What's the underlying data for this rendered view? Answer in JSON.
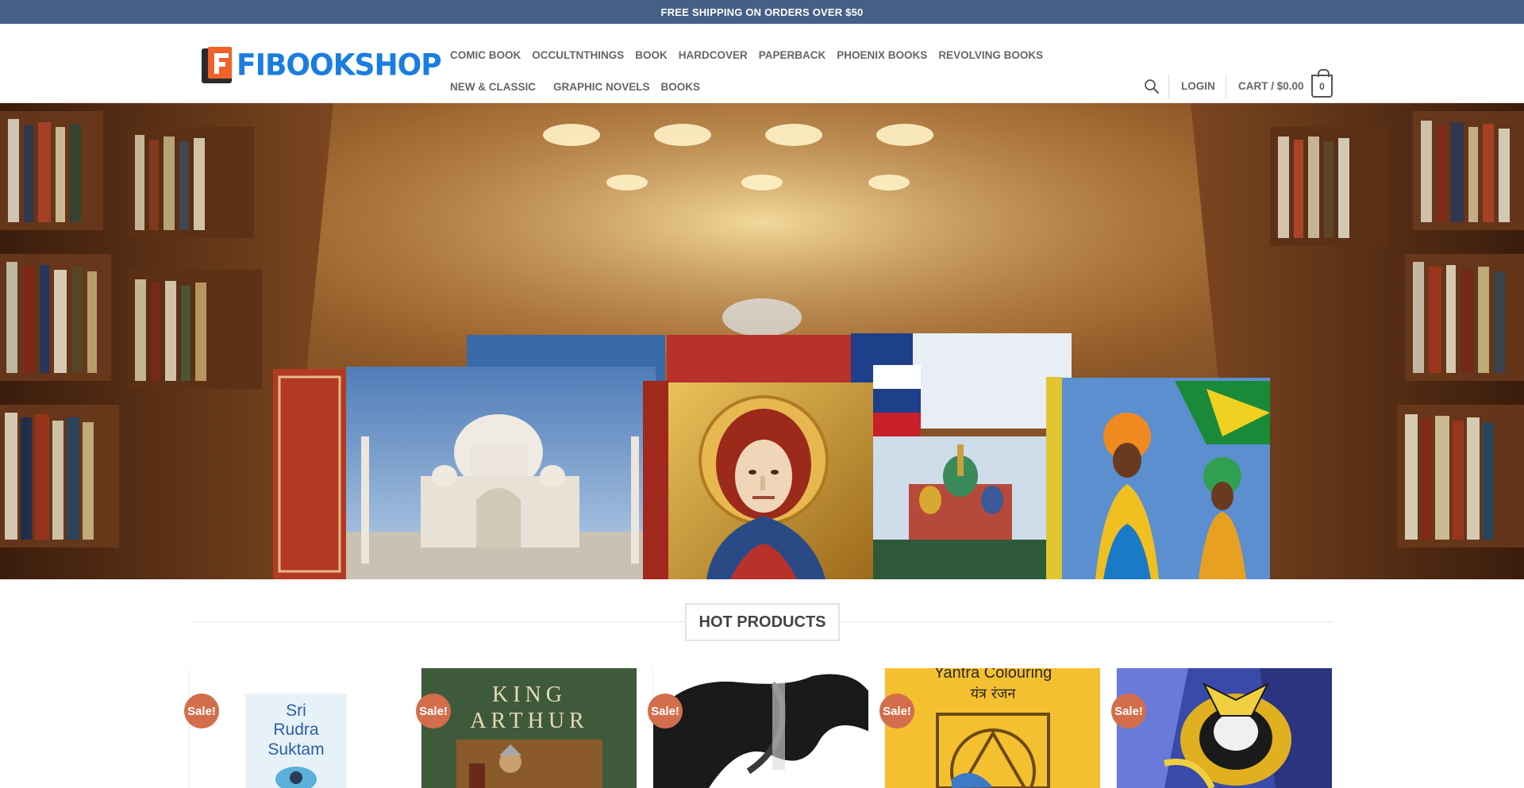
{
  "topbar": {
    "text": "FREE SHIPPING ON ORDERS OVER $50"
  },
  "brand": {
    "name": "FIBOOKSHOP",
    "color": "#1a7de0",
    "accent": "#f0622a"
  },
  "nav": {
    "items": [
      {
        "label": "COMIC BOOK"
      },
      {
        "label": "OCCULTNTHINGS"
      },
      {
        "label": "BOOK"
      },
      {
        "label": "HARDCOVER"
      },
      {
        "label": "PAPERBACK"
      },
      {
        "label": "PHOENIX BOOKS"
      },
      {
        "label": "REVOLVING BOOKS"
      },
      {
        "label": "NEW & CLASSIC"
      },
      {
        "label": "GRAPHIC NOVELS"
      },
      {
        "label": "BOOKS"
      }
    ]
  },
  "header": {
    "search_icon": "search-icon",
    "login_label": "LOGIN",
    "cart_label": "CART / $0.00",
    "cart_count": "0"
  },
  "section": {
    "title": "HOT PRODUCTS"
  },
  "products": [
    {
      "badge": "Sale!",
      "cover_text": "Sri Rudra Suktam"
    },
    {
      "badge": "Sale!",
      "cover_text": "KING ARTHUR"
    },
    {
      "badge": "Sale!",
      "cover_text": ""
    },
    {
      "badge": "Sale!",
      "cover_text": "Yantra Colouring यंत्र रंजन"
    },
    {
      "badge": "Sale!",
      "cover_text": ""
    }
  ],
  "colors": {
    "topbar": "#446084",
    "sale_badge": "#d26e4b"
  }
}
